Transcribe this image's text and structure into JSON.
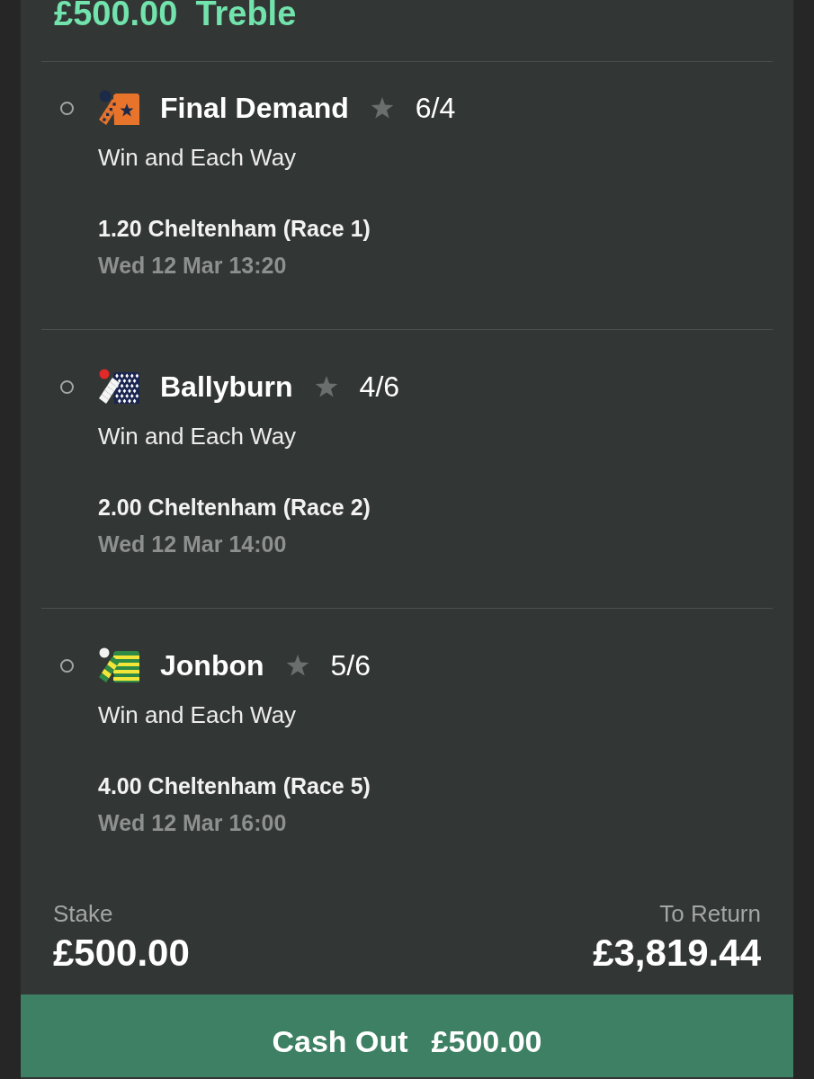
{
  "bet": {
    "stake": "£500.00",
    "type": "Treble"
  },
  "selections": [
    {
      "kind": "star",
      "name": "Final Demand",
      "odds": "6/4",
      "market": "Win and Each Way",
      "race": "1.20 Cheltenham (Race 1)",
      "time": "Wed 12 Mar 13:20"
    },
    {
      "kind": "diamonds",
      "name": "Ballyburn",
      "odds": "4/6",
      "market": "Win and Each Way",
      "race": "2.00 Cheltenham (Race 2)",
      "time": "Wed 12 Mar 14:00"
    },
    {
      "kind": "hoops",
      "name": "Jonbon",
      "odds": "5/6",
      "market": "Win and Each Way",
      "race": "4.00 Cheltenham (Race 5)",
      "time": "Wed 12 Mar 16:00"
    }
  ],
  "summary": {
    "stake_label": "Stake",
    "stake": "£500.00",
    "return_label": "To Return",
    "return": "£3,819.44"
  },
  "cash_out": {
    "label": "Cash Out",
    "amount": "£500.00"
  }
}
